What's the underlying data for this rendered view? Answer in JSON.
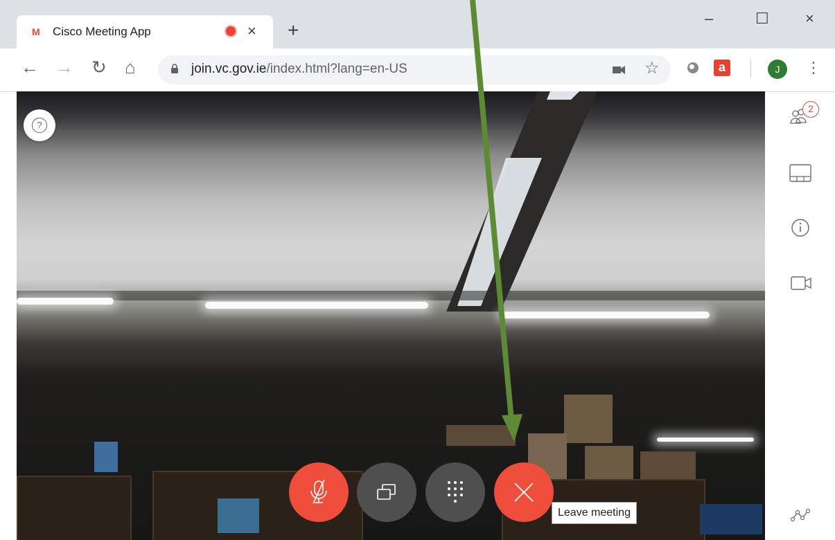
{
  "browser": {
    "tab": {
      "favicon": "M",
      "title": "Cisco Meeting App",
      "close_glyph": "×"
    },
    "new_tab_glyph": "+",
    "window": {
      "minimize": "–",
      "maximize": "☐",
      "close": "×"
    },
    "nav": {
      "back": "←",
      "forward": "→",
      "reload": "↻",
      "home": "⌂"
    },
    "url": {
      "host": "join.vc.gov.ie",
      "path": "/index.html?lang=en-US"
    },
    "star_glyph": "☆",
    "extension_label": "a",
    "avatar_letter": "J",
    "menu_glyph": "⋮"
  },
  "meeting": {
    "help_glyph": "?",
    "participants_badge": "2",
    "controls": [
      {
        "id": "mute",
        "icon": "mic-muted-icon"
      },
      {
        "id": "share",
        "icon": "screen-share-icon"
      },
      {
        "id": "keypad",
        "icon": "dialpad-icon"
      },
      {
        "id": "leave",
        "icon": "close-icon"
      }
    ],
    "tooltip": "Leave meeting"
  },
  "colors": {
    "leave_red": "#ef4e3c",
    "control_grey": "#4f4f4f",
    "annotation_arrow": "#5d8a35"
  }
}
